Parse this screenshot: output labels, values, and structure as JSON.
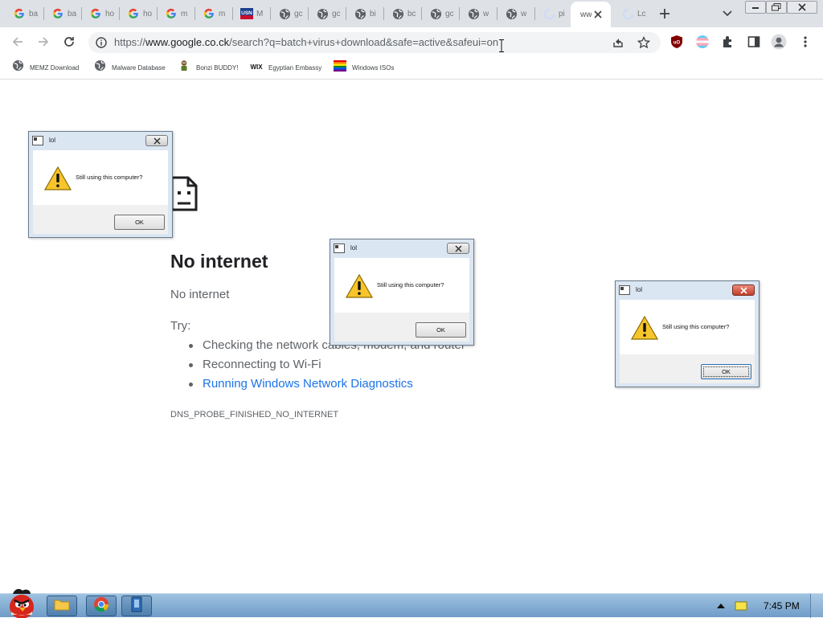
{
  "browser": {
    "tabs": [
      {
        "title": "ba",
        "favicon": "google-g-icon"
      },
      {
        "title": "ba",
        "favicon": "google-g-icon"
      },
      {
        "title": "ho",
        "favicon": "google-g-icon"
      },
      {
        "title": "ho",
        "favicon": "google-g-icon"
      },
      {
        "title": "m",
        "favicon": "google-g-icon"
      },
      {
        "title": "m",
        "favicon": "google-g-icon"
      },
      {
        "title": "M",
        "favicon": "usn-icon"
      },
      {
        "title": "gc",
        "favicon": "globe-icon"
      },
      {
        "title": "gc",
        "favicon": "globe-icon"
      },
      {
        "title": "bi",
        "favicon": "globe-icon"
      },
      {
        "title": "bc",
        "favicon": "globe-icon"
      },
      {
        "title": "gc",
        "favicon": "globe-icon"
      },
      {
        "title": "w",
        "favicon": "globe-icon"
      },
      {
        "title": "w",
        "favicon": "globe-icon"
      },
      {
        "title": "pi",
        "favicon": "loading-spinner-icon"
      },
      {
        "title": "ww",
        "favicon": "none",
        "active": true
      },
      {
        "title": "Lc",
        "favicon": "loading-spinner-icon"
      }
    ],
    "url": {
      "prefix": "https://",
      "host": "www.google.co.ck",
      "path": "/search?q=batch+virus+download&safe=active&safeui=on"
    },
    "bookmarks": [
      {
        "label": "MEMZ Download",
        "icon": "globe-icon"
      },
      {
        "label": "Malware Database",
        "icon": "globe-icon"
      },
      {
        "label": "Bonzi BUDDY!",
        "icon": "bonzi-icon"
      },
      {
        "label": "Egyptian Embassy",
        "icon": "wix-icon"
      },
      {
        "label": "Windows ISOs",
        "icon": "rainbow-flag-icon"
      }
    ]
  },
  "page": {
    "heading": "No internet",
    "subheading": "No internet",
    "try_label": "Try:",
    "suggestions": [
      "Checking the network cables, modem, and router",
      "Reconnecting to Wi-Fi",
      "Running Windows Network Diagnostics"
    ],
    "error_code": "DNS_PROBE_FINISHED_NO_INTERNET"
  },
  "dialogs": [
    {
      "title": "lol",
      "message": "Still using this computer?",
      "ok": "OK"
    },
    {
      "title": "lol",
      "message": "Still using this computer?",
      "ok": "OK"
    },
    {
      "title": "lol",
      "message": "Still using this computer?",
      "ok": "OK"
    }
  ],
  "taskbar": {
    "clock": "7:45 PM",
    "pinned": [
      "folder-icon",
      "chrome-icon",
      "app-icon"
    ]
  },
  "colors": {
    "link": "#1a73e8",
    "tabstrip": "#dee1e6",
    "taskbar": "#6f9cc8"
  }
}
